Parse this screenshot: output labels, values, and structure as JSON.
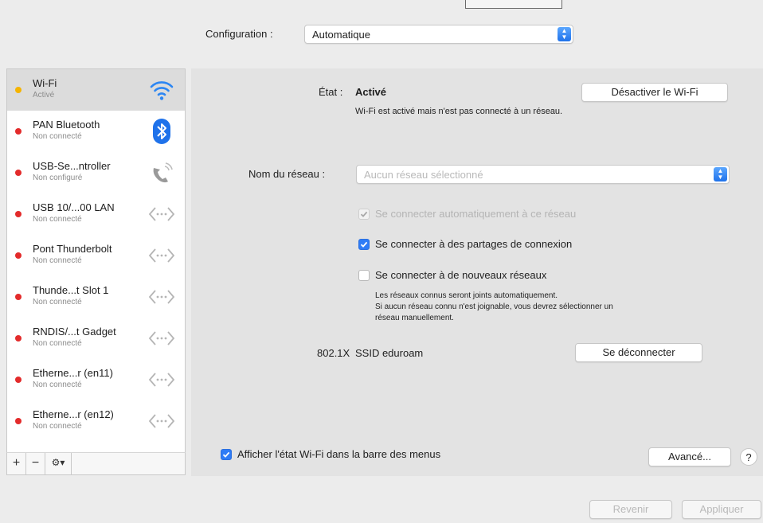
{
  "toolbar": {
    "configuration_label": "Configuration :",
    "configuration_value": "Automatique"
  },
  "sidebar": {
    "services": [
      {
        "name": "Wi-Fi",
        "status": "Activé",
        "dot": "#f5b400",
        "icon": "wifi-icon",
        "selected": true
      },
      {
        "name": "PAN Bluetooth",
        "status": "Non connecté",
        "dot": "#e32b2b",
        "icon": "bluetooth-icon"
      },
      {
        "name": "USB-Se...ntroller",
        "status": "Non configuré",
        "dot": "#e32b2b",
        "icon": "phone-icon"
      },
      {
        "name": "USB 10/...00 LAN",
        "status": "Non connecté",
        "dot": "#e32b2b",
        "icon": "ethernet-icon"
      },
      {
        "name": "Pont Thunderbolt",
        "status": "Non connecté",
        "dot": "#e32b2b",
        "icon": "ethernet-icon"
      },
      {
        "name": "Thunde...t Slot  1",
        "status": "Non connecté",
        "dot": "#e32b2b",
        "icon": "ethernet-icon"
      },
      {
        "name": "RNDIS/...t Gadget",
        "status": "Non connecté",
        "dot": "#e32b2b",
        "icon": "ethernet-icon"
      },
      {
        "name": "Etherne...r (en11)",
        "status": "Non connecté",
        "dot": "#e32b2b",
        "icon": "ethernet-icon"
      },
      {
        "name": "Etherne...r (en12)",
        "status": "Non connecté",
        "dot": "#e32b2b",
        "icon": "ethernet-icon"
      }
    ],
    "add_label": "+",
    "remove_label": "−",
    "action_label": "⚙▾"
  },
  "main": {
    "state_label": "État :",
    "state_value": "Activé",
    "state_description": "Wi-Fi est activé mais n'est pas connecté à un réseau.",
    "toggle_button": "Désactiver le Wi-Fi",
    "network_name_label": "Nom du réseau :",
    "network_name_placeholder": "Aucun réseau sélectionné",
    "auto_join": {
      "label": "Se connecter automatiquement à ce réseau",
      "checked": true,
      "enabled": false
    },
    "hotspots": {
      "label": "Se connecter à des partages de connexion",
      "checked": true
    },
    "new_networks": {
      "label": "Se connecter à de nouveaux réseaux",
      "checked": false
    },
    "new_networks_note": [
      "Les réseaux connus seront joints automatiquement.",
      "Si aucun réseau connu n'est joignable, vous devrez sélectionner un",
      "réseau manuellement."
    ],
    "dot1x_label": "802.1X",
    "dot1x_value": "SSID eduroam",
    "disconnect_button": "Se déconnecter",
    "show_status": {
      "label": "Afficher l'état Wi-Fi dans la barre des menus",
      "checked": true
    },
    "advanced_button": "Avancé...",
    "help_label": "?"
  },
  "footer": {
    "revert_button": "Revenir",
    "apply_button": "Appliquer"
  },
  "colors": {
    "accent": "#2f7cf6",
    "dot_active": "#f5b400",
    "dot_inactive": "#e32b2b"
  }
}
